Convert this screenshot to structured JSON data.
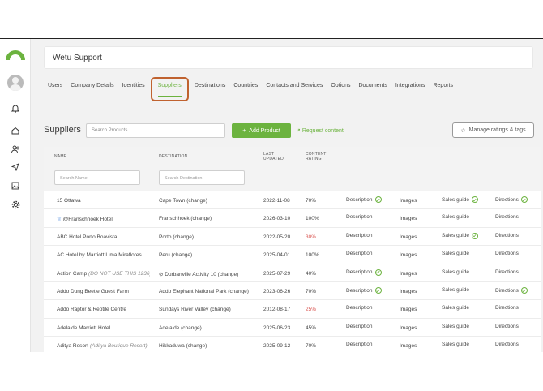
{
  "app": {
    "title": "Wetu Support"
  },
  "colors": {
    "accent": "#6cb33f",
    "highlight": "#c0622f",
    "low_rating": "#d9534f"
  },
  "sidebar": {
    "icons": [
      "bell-icon",
      "home-icon",
      "users-icon",
      "send-icon",
      "image-icon",
      "gear-icon"
    ]
  },
  "tabs": [
    {
      "label": "Users"
    },
    {
      "label": "Company Details"
    },
    {
      "label": "Identities"
    },
    {
      "label": "Suppliers",
      "active": true
    },
    {
      "label": "Destinations"
    },
    {
      "label": "Countries"
    },
    {
      "label": "Contacts and Services"
    },
    {
      "label": "Options"
    },
    {
      "label": "Documents"
    },
    {
      "label": "Integrations"
    },
    {
      "label": "Reports"
    }
  ],
  "toolbar": {
    "title": "Suppliers",
    "search_placeholder": "Search Products",
    "add_label": "Add Product",
    "request_label": "Request content",
    "manage_label": "Manage ratings & tags"
  },
  "table": {
    "headers": {
      "name": "NAME",
      "destination": "DESTINATION",
      "updated_1": "LAST",
      "updated_2": "UPDATED",
      "content_1": "CONTENT",
      "content_2": "RATING"
    },
    "search_name_placeholder": "Search Name",
    "search_dest_placeholder": "Search Destination",
    "rows": [
      {
        "name": "15 Ottawa",
        "destination": "Cape Town",
        "change": "(change)",
        "updated": "2022-11-08",
        "rating": "70%",
        "low": false,
        "desc_check": true,
        "sales_check": true,
        "dir_check": true
      },
      {
        "name": "@Franschhoek Hotel",
        "destination": "Franschhoek",
        "change": "(change)",
        "updated": "2026-03-10",
        "rating": "100%",
        "low": false,
        "desc_check": false,
        "sales_check": false,
        "dir_check": false,
        "crown": true
      },
      {
        "name": "ABC Hotel Porto Boavista",
        "destination": "Porto",
        "change": "(change)",
        "updated": "2022-05-20",
        "rating": "30%",
        "low": true,
        "desc_check": false,
        "sales_check": true,
        "dir_check": false
      },
      {
        "name": "AC Hotel by Marriott Lima Miraflores",
        "destination": "Peru",
        "change": "(change)",
        "updated": "2025-04-01",
        "rating": "100%",
        "low": false,
        "desc_check": false,
        "sales_check": false,
        "dir_check": false
      },
      {
        "name": "Action Camp",
        "name_note": "(DO NOT USE THIS 1236)",
        "destination": "Durbanville Activity 10",
        "change": "(change)",
        "updated": "2025-07-29",
        "rating": "40%",
        "low": false,
        "desc_check": true,
        "sales_check": false,
        "dir_check": false,
        "hidden_icon": true
      },
      {
        "name": "Addo Dung Beetle Guest Farm",
        "destination": "Addo Elephant National Park",
        "change": "(change)",
        "updated": "2023-06-26",
        "rating": "70%",
        "low": false,
        "desc_check": true,
        "sales_check": false,
        "dir_check": true
      },
      {
        "name": "Addo Raptor & Reptile Centre",
        "destination": "Sundays River Valley",
        "change": "(change)",
        "updated": "2012-08-17",
        "rating": "25%",
        "low": true,
        "desc_check": false,
        "sales_check": false,
        "dir_check": false
      },
      {
        "name": "Adelaide Marriott Hotel",
        "destination": "Adelaide",
        "change": "(change)",
        "updated": "2025-06-23",
        "rating": "45%",
        "low": false,
        "desc_check": false,
        "sales_check": false,
        "dir_check": false
      },
      {
        "name": "Aditya Resort",
        "name_note": "(Aditya Boutique Resort)",
        "destination": "Hikkaduwa",
        "change": "(change)",
        "updated": "2025-09-12",
        "rating": "70%",
        "low": false,
        "desc_check": false,
        "sales_check": false,
        "dir_check": false
      }
    ],
    "labels": {
      "description": "Description",
      "images": "Images",
      "sales": "Sales guide",
      "directions": "Directions"
    }
  }
}
